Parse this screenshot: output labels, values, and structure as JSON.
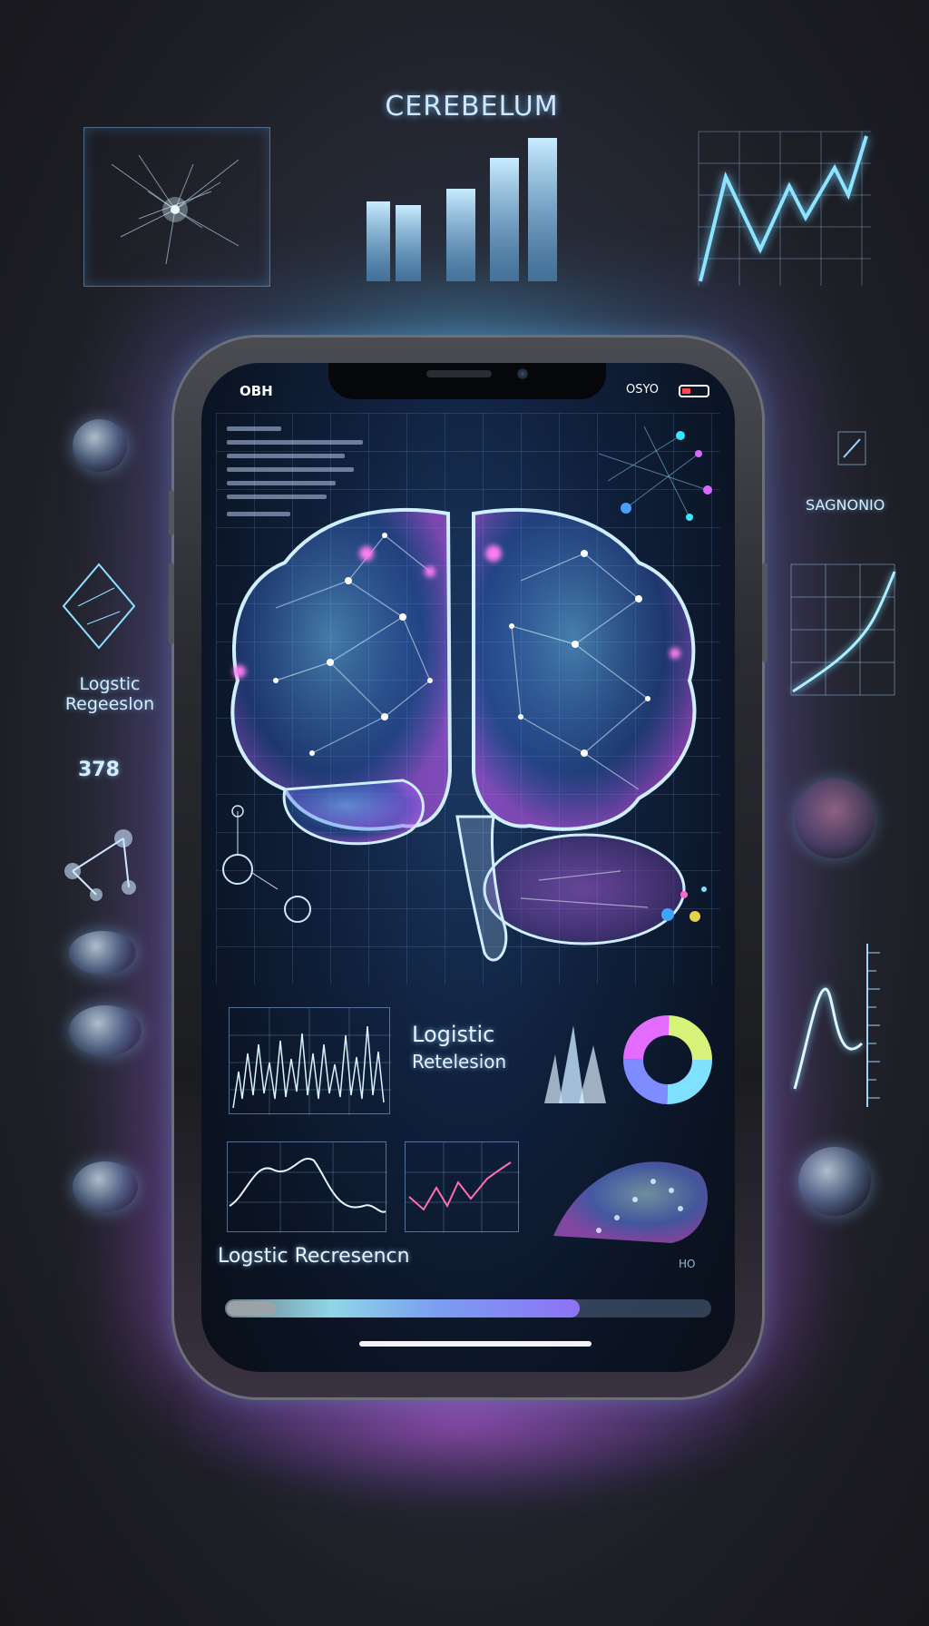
{
  "header": {
    "title": "CEREBELUM"
  },
  "left_panel": {
    "label_line1": "Logstic",
    "label_line2": "Regeeslon",
    "number": "378"
  },
  "right_panel": {
    "label": "SAGNONIO"
  },
  "status_bar": {
    "left_text": "OBH",
    "right_text": "OSYO",
    "battery_level": 0.35
  },
  "screen": {
    "card_title_line1": "Logistic",
    "card_title_line2": "Retelesion",
    "footer_caption": "Logstic Recresencn",
    "corner_code": "HO"
  },
  "progress": {
    "value": 0.73
  },
  "colors": {
    "accent_cyan": "#7fe0ff",
    "accent_magenta": "#e06cff",
    "accent_blue": "#6f8cff"
  }
}
